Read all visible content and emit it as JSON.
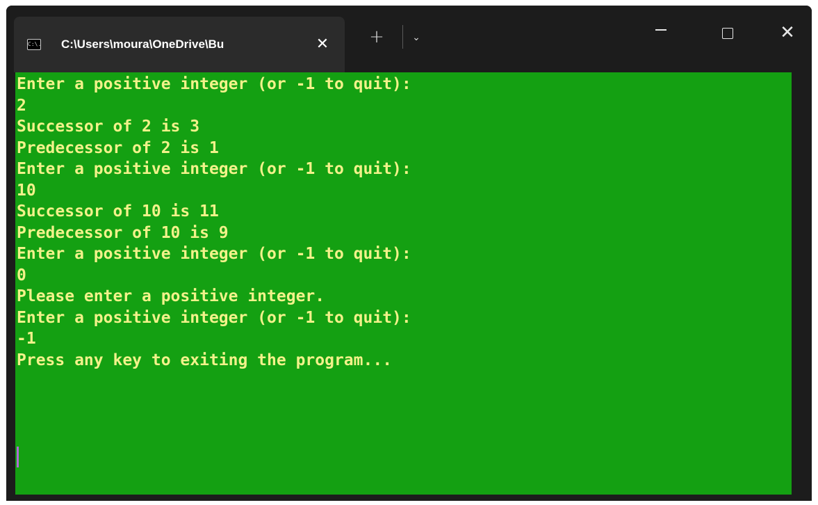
{
  "window": {
    "tab_icon_text": "C:\\.",
    "tab_title": "C:\\Users\\moura\\OneDrive\\Bu",
    "tab_close": "✕",
    "new_tab": "+",
    "dropdown": "⌄",
    "close_symbol": "✕"
  },
  "colors": {
    "terminal_background": "#14a012",
    "terminal_text": "#f2f28a",
    "titlebar_background": "#1c1c1c",
    "tab_background": "#2b2b2b",
    "cursor": "#b06ad9"
  },
  "icons": {
    "tab_icon": "terminal-icon",
    "close_tab": "close-icon",
    "new_tab": "plus-icon",
    "dropdown": "chevron-down-icon",
    "minimize": "minimize-icon",
    "maximize": "maximize-icon",
    "close_window": "close-icon"
  },
  "terminal": {
    "lines": [
      "Enter a positive integer (or -1 to quit):",
      "2",
      "Successor of 2 is 3",
      "Predecessor of 2 is 1",
      "Enter a positive integer (or -1 to quit):",
      "10",
      "Successor of 10 is 11",
      "Predecessor of 10 is 9",
      "Enter a positive integer (or -1 to quit):",
      "0",
      "Please enter a positive integer.",
      "Enter a positive integer (or -1 to quit):",
      "-1",
      "Press any key to exiting the program..."
    ]
  }
}
